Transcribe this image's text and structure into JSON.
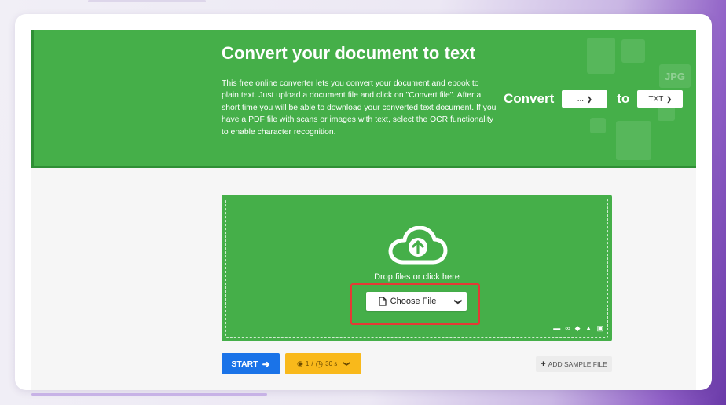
{
  "hero": {
    "title": "Convert your document to text",
    "description": "This free online converter lets you convert your document and ebook to plain text. Just upload a document file and click on \"Convert file\". After a short time you will be able to download your converted text document. If you have a PDF file with scans or images with text, select the OCR functionality to enable character recognition.",
    "convert_label": "Convert",
    "from_value": "...",
    "to_label": "to",
    "to_value": "TXT",
    "bg_label": "JPG"
  },
  "dropzone": {
    "drop_text": "Drop files or click here",
    "choose_file_label": "Choose File",
    "source_icons": [
      "folder-icon",
      "link-icon",
      "dropbox-icon",
      "google-drive-icon",
      "clipboard-icon"
    ]
  },
  "actions": {
    "start_label": "START",
    "limits_files": "1",
    "limits_sep": "/",
    "limits_time": "30 s",
    "sample_label": "ADD SAMPLE FILE"
  },
  "colors": {
    "brand_green": "#45af49",
    "start_blue": "#1a73e8",
    "limits_orange": "#f9b91b",
    "highlight_red": "#e53935"
  }
}
